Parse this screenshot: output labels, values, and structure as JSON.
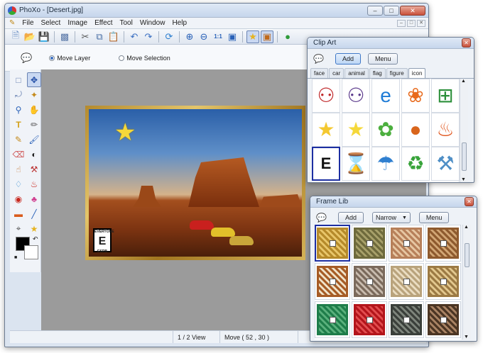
{
  "main_window": {
    "title": "PhoXo - [Desert.jpg]",
    "caption_buttons": [
      "–",
      "□",
      "✕"
    ],
    "mdi_buttons": [
      "–",
      "□",
      "✕"
    ],
    "menu": [
      "File",
      "Select",
      "Image",
      "Effect",
      "Tool",
      "Window",
      "Help"
    ],
    "options": {
      "move_layer": "Move Layer",
      "move_selection": "Move Selection",
      "selected": "move_layer"
    },
    "status": {
      "view": "1 / 2 View",
      "position": "Move ( 52 , 30 )"
    },
    "colors": {
      "foreground": "#000000",
      "background": "#ffffff"
    },
    "canvas": {
      "image_name": "Desert.jpg",
      "esrb_text": "E",
      "esrb_top": "EVERYONE",
      "esrb_bottom": "ESRB"
    }
  },
  "clip_art": {
    "title": "Clip Art",
    "add_label": "Add",
    "menu_label": "Menu",
    "tabs": [
      "face",
      "car",
      "animal",
      "flag",
      "figure",
      "icon"
    ],
    "active_tab": "icon",
    "items": [
      {
        "icon": "autobot-icon",
        "glyph": "⚇",
        "color": "#c0282a"
      },
      {
        "icon": "decepticon-icon",
        "glyph": "⚇",
        "color": "#5b3a8c"
      },
      {
        "icon": "internet-explorer-icon",
        "glyph": "e",
        "color": "#1e7bd6"
      },
      {
        "icon": "msn-butterfly-icon",
        "glyph": "❀",
        "color": "#e86a1c"
      },
      {
        "icon": "windows-logo-icon",
        "glyph": "⊞",
        "color": "#2b8f3a"
      },
      {
        "icon": "star-icon",
        "glyph": "★",
        "color": "#f4c830"
      },
      {
        "icon": "smiling-star-icon",
        "glyph": "★",
        "color": "#f5d83a"
      },
      {
        "icon": "green-gear-face-icon",
        "glyph": "✿",
        "color": "#4caf3e"
      },
      {
        "icon": "basketball-icon",
        "glyph": "●",
        "color": "#d9651c"
      },
      {
        "icon": "campfire-icon",
        "glyph": "♨",
        "color": "#e0541b"
      },
      {
        "icon": "esrb-everyone-icon",
        "glyph": "E",
        "color": "#111111"
      },
      {
        "icon": "hourglass-icon",
        "glyph": "⌛",
        "color": "#3d8ee0"
      },
      {
        "icon": "beach-umbrella-icon",
        "glyph": "☂",
        "color": "#2f7fd0"
      },
      {
        "icon": "recycle-icon",
        "glyph": "♻",
        "color": "#38a33a"
      },
      {
        "icon": "water-faucet-icon",
        "glyph": "⚒",
        "color": "#4f8fc6"
      }
    ]
  },
  "frame_lib": {
    "title": "Frame Lib",
    "add_label": "Add",
    "filter_value": "Narrow",
    "menu_label": "Menu",
    "frames": [
      {
        "outer": "#b58a2a",
        "inner": "#e8c66a"
      },
      {
        "outer": "#6e6a3c",
        "inner": "#a7a06a"
      },
      {
        "outer": "#b7805a",
        "inner": "#e6c6a2"
      },
      {
        "outer": "#8e5a2e",
        "inner": "#d1a574"
      },
      {
        "outer": "#a65c26",
        "inner": "#f0e2c8"
      },
      {
        "outer": "#7b6a5c",
        "inner": "#c8bbae"
      },
      {
        "outer": "#b9a37c",
        "inner": "#eadcc1"
      },
      {
        "outer": "#9c7a44",
        "inner": "#e2c78e"
      },
      {
        "outer": "#1e7d4a",
        "inner": "#5ab07c"
      },
      {
        "outer": "#b3151b",
        "inner": "#e24d4f"
      },
      {
        "outer": "#3a3f3a",
        "inner": "#7e857c"
      },
      {
        "outer": "#4b3523",
        "inner": "#a98364"
      }
    ]
  }
}
